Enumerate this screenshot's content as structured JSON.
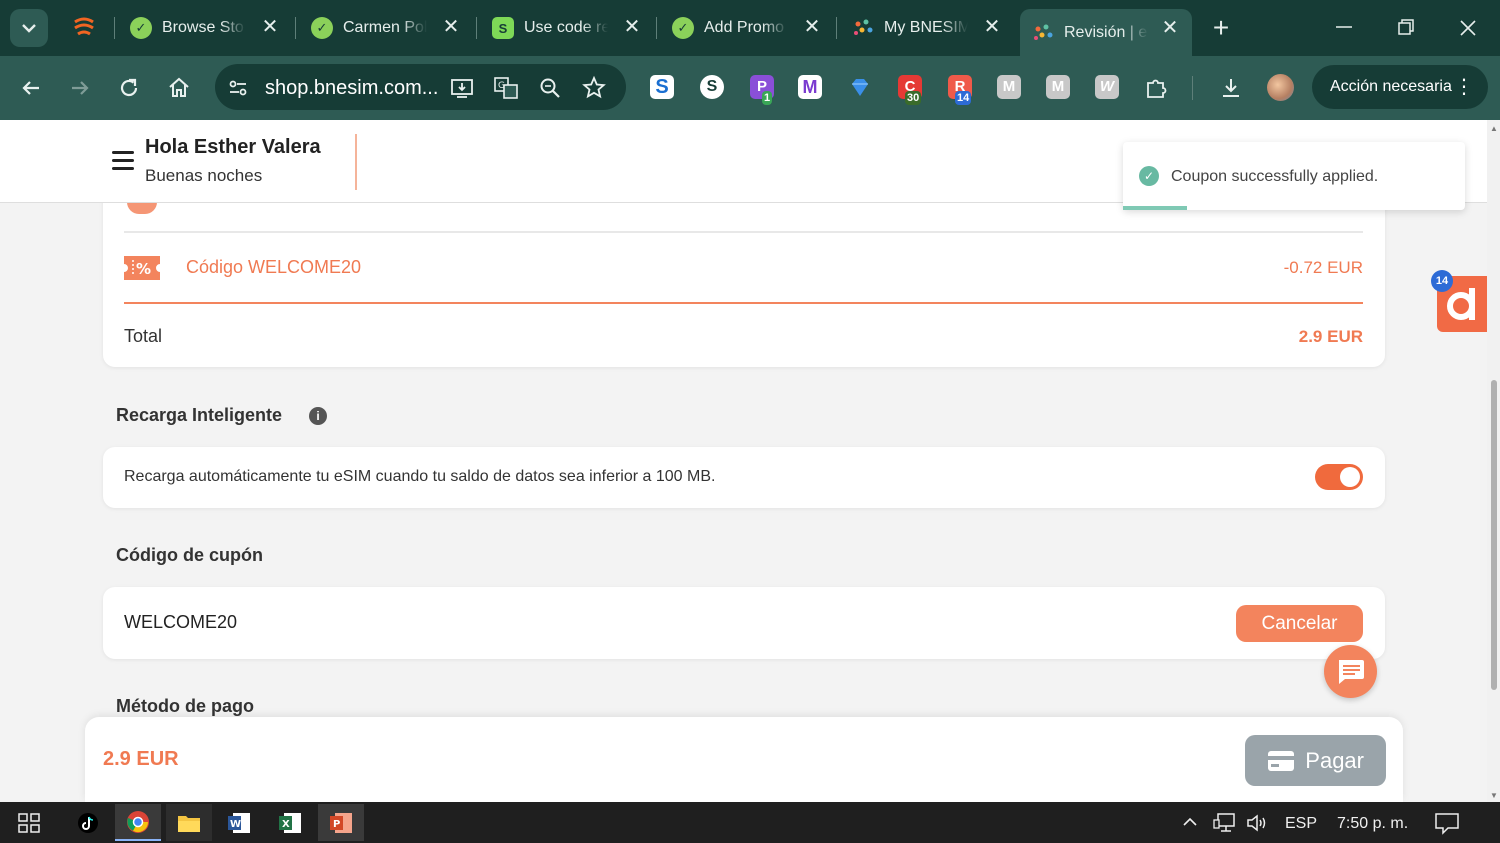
{
  "browser": {
    "tabs": [
      {
        "title": "Browse Sto",
        "favicon": "green-check-icon"
      },
      {
        "title": "Carmen Pol",
        "favicon": "green-check-icon"
      },
      {
        "title": "Use code re",
        "favicon": "s-logo-icon"
      },
      {
        "title": "Add Promo",
        "favicon": "green-check-icon"
      },
      {
        "title": "My BNESIM",
        "favicon": "bnesim-dots-icon"
      },
      {
        "title": "Revisión | e",
        "favicon": "bnesim-dots-icon",
        "active": true
      }
    ],
    "url": "shop.bnesim.com...",
    "action_button": "Acción necesaria",
    "extension_badges": {
      "badge_1": "1",
      "badge_30": "30",
      "badge_14": "14"
    }
  },
  "header": {
    "greeting_name": "Hola Esther Valera",
    "greeting_sub": "Buenas noches"
  },
  "toast": {
    "message": "Coupon successfully applied."
  },
  "summary": {
    "coupon_label": "Código WELCOME20",
    "coupon_amount": "-0.72 EUR",
    "total_label": "Total",
    "total_value": "2.9 EUR"
  },
  "smart_recharge": {
    "title": "Recarga Inteligente",
    "description": "Recarga automáticamente tu eSIM cuando tu saldo de datos sea inferior a 100 MB.",
    "enabled": true
  },
  "coupon": {
    "title": "Código de cupón",
    "code": "WELCOME20",
    "cancel_label": "Cancelar"
  },
  "payment": {
    "title": "Método de pago",
    "amount": "2.9 EUR",
    "pay_label": "Pagar"
  },
  "side_widget": {
    "badge": "14"
  },
  "taskbar": {
    "language": "ESP",
    "time": "7:50 p. m."
  },
  "colors": {
    "accent": "#f3845d",
    "accent_text": "#f07a52",
    "chrome_dark": "#163c36",
    "chrome_mid": "#2e5b54",
    "toast_check": "#68b9a2"
  }
}
